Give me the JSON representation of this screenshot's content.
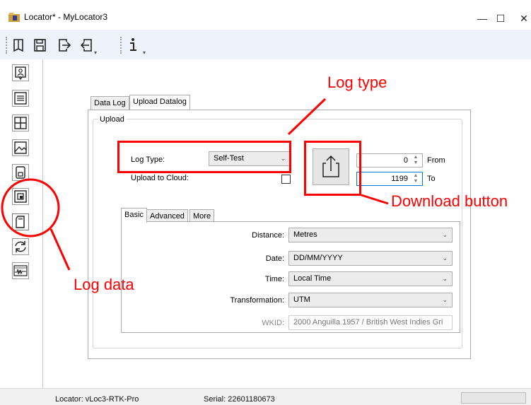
{
  "window": {
    "title": "Locator* - MyLocator3",
    "minimize_glyph": "—",
    "maximize_glyph": "☐",
    "close_glyph": "✕"
  },
  "toolbar": {
    "icons": [
      "open-locator-icon",
      "save-icon",
      "export-icon",
      "import-icon",
      "info-icon"
    ]
  },
  "sidebar": {
    "items": [
      {
        "icon": "locator-info-icon"
      },
      {
        "icon": "settings-list-icon"
      },
      {
        "icon": "grid-icon"
      },
      {
        "icon": "image-icon"
      },
      {
        "icon": "memory-icon"
      },
      {
        "icon": "copy-config-icon"
      },
      {
        "icon": "sd-card-icon",
        "selected": true
      },
      {
        "icon": "sync-icon"
      },
      {
        "icon": "signal-waveform-icon"
      }
    ]
  },
  "tabs": [
    "Data Log",
    "Upload Datalog"
  ],
  "active_tab": "Upload Datalog",
  "upload": {
    "group_label": "Upload",
    "log_type_label": "Log Type:",
    "log_type_value": "Self-Test",
    "upload_cloud_label": "Upload to Cloud:",
    "upload_cloud_checked": false,
    "from_value": "0",
    "from_label": "From",
    "to_value": "1199",
    "to_label": "To"
  },
  "settings_tabs": [
    "Basic",
    "Advanced",
    "More"
  ],
  "active_settings_tab": "Basic",
  "settings": {
    "distance_label": "Distance:",
    "distance_value": "Metres",
    "date_label": "Date:",
    "date_value": "DD/MM/YYYY",
    "time_label": "Time:",
    "time_value": "Local Time",
    "transformation_label": "Transformation:",
    "transformation_value": "UTM",
    "wkid_label": "WKID:",
    "wkid_value": "2000 Anguilla 1957 / British West Indies Gri"
  },
  "annotations": {
    "log_type": "Log type",
    "download_button": "Download button",
    "log_data": "Log data",
    "color": "#ff0000"
  },
  "status": {
    "locator": "Locator: vLoc3-RTK-Pro",
    "serial": "Serial: 22601180673"
  }
}
